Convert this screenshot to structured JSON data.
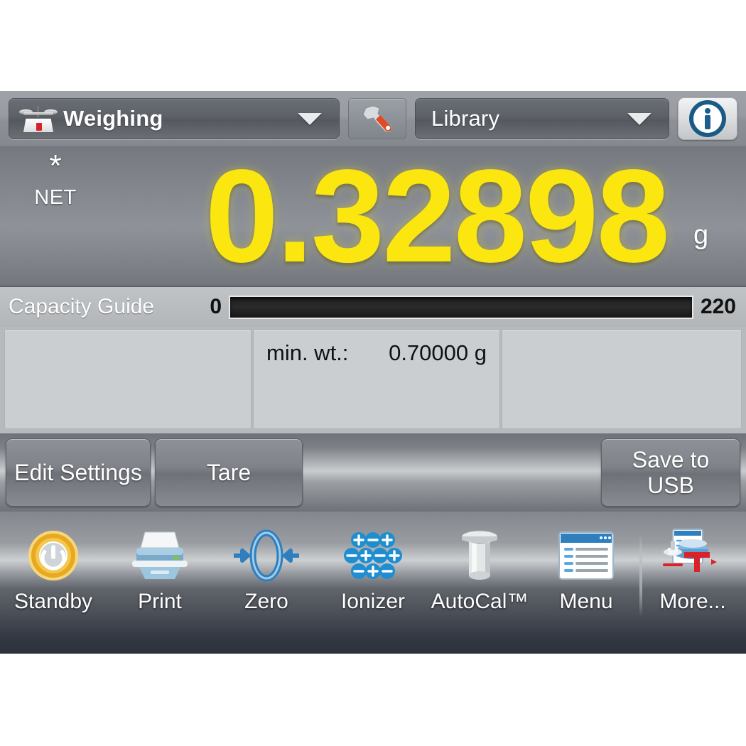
{
  "header": {
    "mode_dropdown": {
      "label": "Weighing",
      "icon": "balance-scale-icon"
    },
    "settings_button": {
      "icon": "wrench-icon"
    },
    "library_dropdown": {
      "label": "Library"
    },
    "info_button": {
      "icon": "info-icon"
    }
  },
  "display": {
    "stability_indicator": "*",
    "net_indicator": "NET",
    "value": "0.32898",
    "unit": "g",
    "value_color": "#fbe610"
  },
  "capacity": {
    "label": "Capacity Guide",
    "min": "0",
    "max": "220",
    "fill_percent": 0
  },
  "panels": [
    {
      "key": "",
      "value": ""
    },
    {
      "key": "min. wt.:",
      "value": "0.70000 g"
    },
    {
      "key": "",
      "value": ""
    }
  ],
  "buttons": {
    "edit_settings": "Edit Settings",
    "tare": "Tare",
    "save_to_usb": "Save to\nUSB",
    "save_to_usb_line1": "Save to",
    "save_to_usb_line2": "USB"
  },
  "toolbar": [
    {
      "label": "Standby",
      "icon": "power-standby-icon"
    },
    {
      "label": "Print",
      "icon": "printer-icon"
    },
    {
      "label": "Zero",
      "icon": "zero-arrows-icon"
    },
    {
      "label": "Ionizer",
      "icon": "ions-plus-minus-icon"
    },
    {
      "label": "AutoCal™",
      "icon": "calibration-weight-icon"
    },
    {
      "label": "Menu",
      "icon": "menu-window-icon"
    },
    {
      "label": "More...",
      "icon": "more-apps-icon"
    }
  ]
}
